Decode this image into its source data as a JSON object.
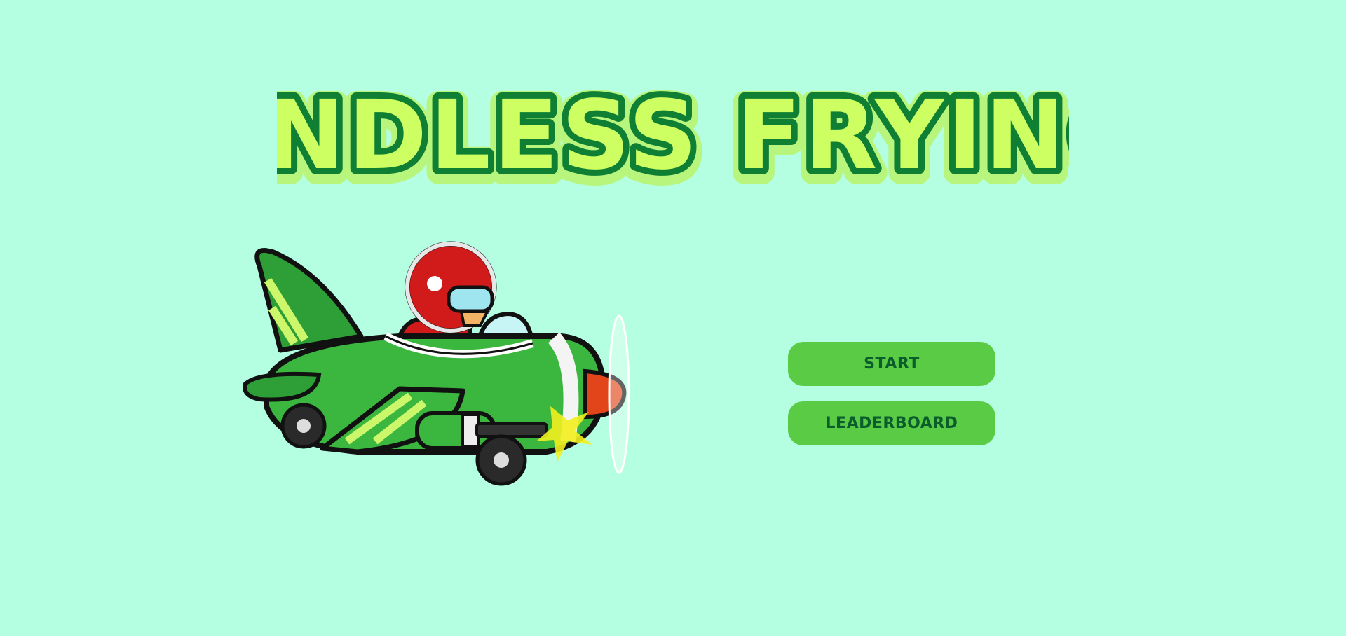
{
  "game": {
    "title": "ENDLESS FRYING"
  },
  "menu": {
    "start_label": "START",
    "leaderboard_label": "LEADERBOARD"
  },
  "colors": {
    "background": "#b4ffe1",
    "title_fill": "#cdff63",
    "title_outline": "#0e7f33",
    "title_glow": "#b8f57d",
    "button_bg": "#5acb45",
    "button_text": "#0b5e2c"
  },
  "sprites": {
    "plane": "green-cartoon-airplane-with-helmeted-pilot"
  }
}
